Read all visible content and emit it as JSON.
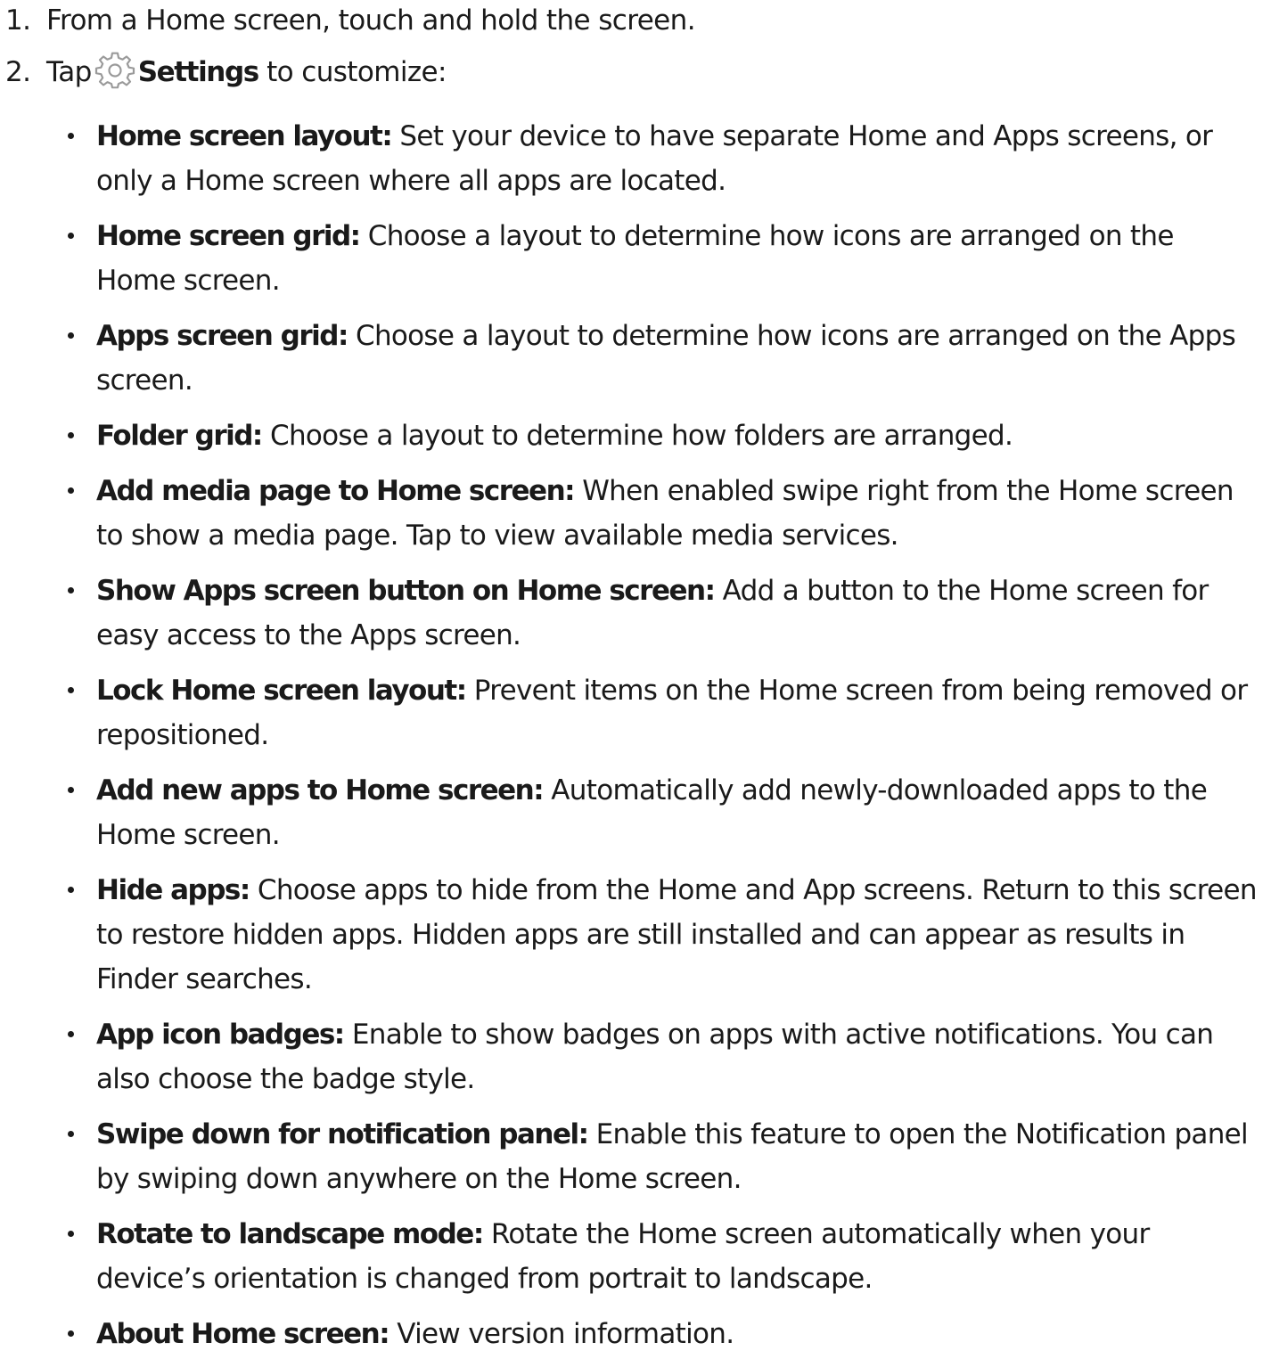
{
  "steps": [
    {
      "number": "1.",
      "text": "From a Home screen, touch and hold the screen."
    },
    {
      "number": "2.",
      "prefix": "Tap",
      "icon": "settings-gear-icon",
      "bold": "Settings",
      "suffix": " to customize:"
    }
  ],
  "options": [
    {
      "term": "Home screen layout:",
      "desc": " Set your device to have separate Home and Apps screens, or only a Home screen where all apps are located."
    },
    {
      "term": "Home screen grid:",
      "desc": " Choose a layout to determine how icons are arranged on the Home screen."
    },
    {
      "term": "Apps screen grid:",
      "desc": " Choose a layout to determine how icons are arranged on the Apps screen."
    },
    {
      "term": "Folder grid:",
      "desc": " Choose a layout to determine how folders are arranged."
    },
    {
      "term": "Add media page to Home screen:",
      "desc": " When enabled swipe right from the Home screen to show a media page. Tap to view available media services."
    },
    {
      "term": "Show Apps screen button on Home screen:",
      "desc": " Add a button to the Home screen for easy access to the Apps screen."
    },
    {
      "term": "Lock Home screen layout:",
      "desc": " Prevent items on the Home screen from being removed or repositioned."
    },
    {
      "term": "Add new apps to Home screen:",
      "desc": " Automatically add newly-downloaded apps to the Home screen."
    },
    {
      "term": "Hide apps:",
      "desc": " Choose apps to hide from the Home and App screens. Return to this screen to restore hidden apps. Hidden apps are still installed and can appear as results in Finder searches."
    },
    {
      "term": "App icon badges:",
      "desc": " Enable to show badges on apps with active notifications. You can also choose the badge style."
    },
    {
      "term": "Swipe down for notification panel:",
      "desc": " Enable this feature to open the Notification panel by swiping down anywhere on the Home screen."
    },
    {
      "term": "Rotate to landscape mode:",
      "desc": " Rotate the Home screen automatically when your device’s orientation is changed from portrait to landscape."
    },
    {
      "term": "About Home screen:",
      "desc": " View version information."
    }
  ]
}
